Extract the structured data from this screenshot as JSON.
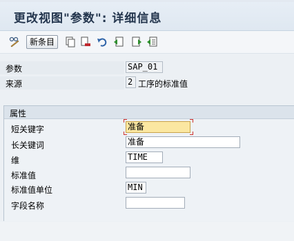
{
  "header": {
    "title": "更改视图\"参数\": 详细信息"
  },
  "toolbar": {
    "new_entries_label": "新条目",
    "icons": [
      "edit-glasses-icon",
      "copy-icon",
      "delete-icon",
      "undo-icon",
      "previous-entry-icon",
      "next-entry-icon",
      "select-all-icon"
    ]
  },
  "form": {
    "parameter_label": "参数",
    "parameter_value": "SAP_01",
    "source_label": "来源",
    "source_code": "2",
    "source_text": "工序的标准值"
  },
  "attributes": {
    "group_title": "属性",
    "short_keyword_label": "短关键字",
    "short_keyword_value": "准备",
    "long_keyword_label": "长关键词",
    "long_keyword_value": "准备",
    "dimension_label": "维",
    "dimension_value": "TIME",
    "standard_value_label": "标准值",
    "standard_value_value": "",
    "standard_value_unit_label": "标准值单位",
    "standard_value_unit_value": "MIN",
    "field_name_label": "字段名称",
    "field_name_value": ""
  }
}
